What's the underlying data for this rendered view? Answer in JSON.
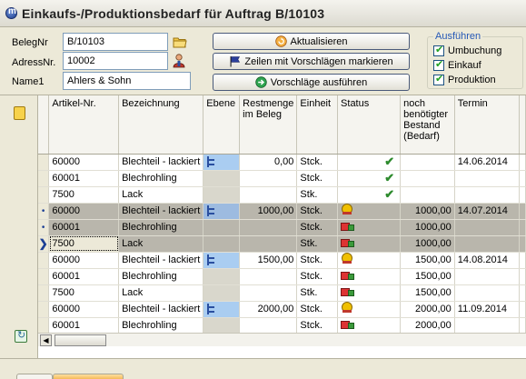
{
  "window": {
    "title": "Einkaufs-/Produktionsbedarf für Auftrag B/10103"
  },
  "form": {
    "belegnr_label": "BelegNr",
    "belegnr_value": "B/10103",
    "adressnr_label": "AdressNr.",
    "adressnr_value": "10002",
    "name1_label": "Name1",
    "name1_value": "Ahlers & Sohn"
  },
  "buttons": {
    "aktualisieren": "Aktualisieren",
    "markieren": "Zeilen mit Vorschlägen markieren",
    "ausfuehren": "Vorschläge ausführen"
  },
  "ausfuehren_group": {
    "legend": "Ausführen",
    "umbuchung": "Umbuchung",
    "einkauf": "Einkauf",
    "produktion": "Produktion"
  },
  "grid": {
    "headers": {
      "artikel": "Artikel-Nr.",
      "bezeichnung": "Bezeichnung",
      "ebene": "Ebene",
      "restmenge": "Restmenge im Beleg",
      "einheit": "Einheit",
      "status": "Status",
      "bedarf": "noch benötigter Bestand (Bedarf)",
      "termin": "Termin"
    },
    "rows": [
      {
        "artikel": "60000",
        "bez": "Blechteil - lackiert",
        "restmenge": "0,00",
        "einheit": "Stck.",
        "bedarf": "",
        "termin": "14.06.2014"
      },
      {
        "artikel": "60001",
        "bez": "Blechrohling",
        "restmenge": "",
        "einheit": "Stck.",
        "bedarf": "",
        "termin": ""
      },
      {
        "artikel": "7500",
        "bez": "Lack",
        "restmenge": "",
        "einheit": "Stk.",
        "bedarf": "",
        "termin": ""
      },
      {
        "artikel": "60000",
        "bez": "Blechteil - lackiert",
        "restmenge": "1000,00",
        "einheit": "Stck.",
        "bedarf": "1000,00",
        "termin": "14.07.2014"
      },
      {
        "artikel": "60001",
        "bez": "Blechrohling",
        "restmenge": "",
        "einheit": "Stck.",
        "bedarf": "1000,00",
        "termin": ""
      },
      {
        "artikel": "7500",
        "bez": "Lack",
        "restmenge": "",
        "einheit": "Stk.",
        "bedarf": "1000,00",
        "termin": ""
      },
      {
        "artikel": "60000",
        "bez": "Blechteil - lackiert",
        "restmenge": "1500,00",
        "einheit": "Stck.",
        "bedarf": "1500,00",
        "termin": "14.08.2014"
      },
      {
        "artikel": "60001",
        "bez": "Blechrohling",
        "restmenge": "",
        "einheit": "Stck.",
        "bedarf": "1500,00",
        "termin": ""
      },
      {
        "artikel": "7500",
        "bez": "Lack",
        "restmenge": "",
        "einheit": "Stk.",
        "bedarf": "1500,00",
        "termin": ""
      },
      {
        "artikel": "60000",
        "bez": "Blechteil - lackiert",
        "restmenge": "2000,00",
        "einheit": "Stck.",
        "bedarf": "2000,00",
        "termin": "11.09.2014"
      },
      {
        "artikel": "60001",
        "bez": "Blechrohling",
        "restmenge": "",
        "einheit": "Stck.",
        "bedarf": "2000,00",
        "termin": ""
      }
    ]
  }
}
